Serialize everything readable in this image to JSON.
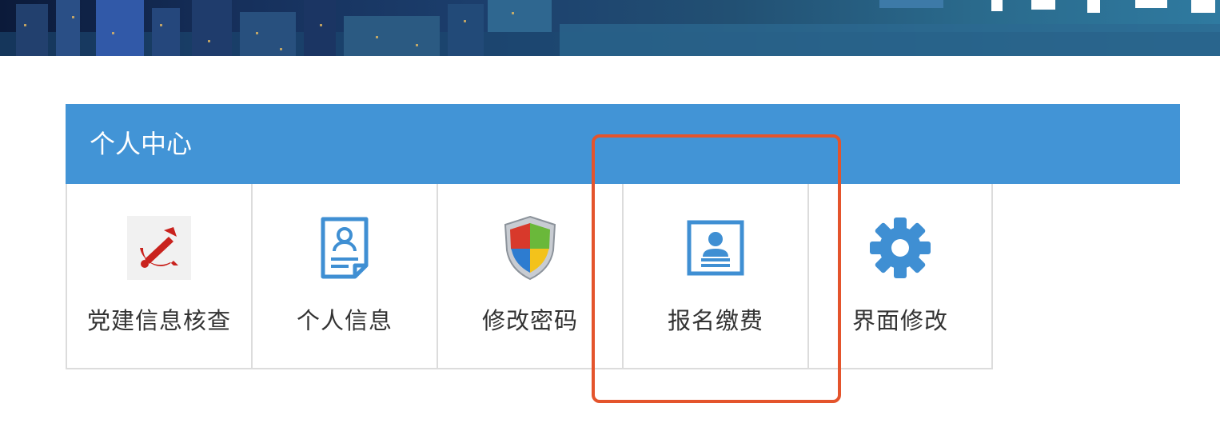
{
  "panel": {
    "title": "个人中心",
    "items": [
      {
        "label": "党建信息核查",
        "icon": "hammer-sickle-icon"
      },
      {
        "label": "个人信息",
        "icon": "profile-document-icon"
      },
      {
        "label": "修改密码",
        "icon": "shield-icon"
      },
      {
        "label": "报名缴费",
        "icon": "id-card-icon"
      },
      {
        "label": "界面修改",
        "icon": "gear-icon"
      }
    ]
  },
  "colors": {
    "header_bg": "#4294d6",
    "highlight_border": "#e4542c",
    "party_red": "#c9231e",
    "icon_blue": "#3f8fd3"
  }
}
